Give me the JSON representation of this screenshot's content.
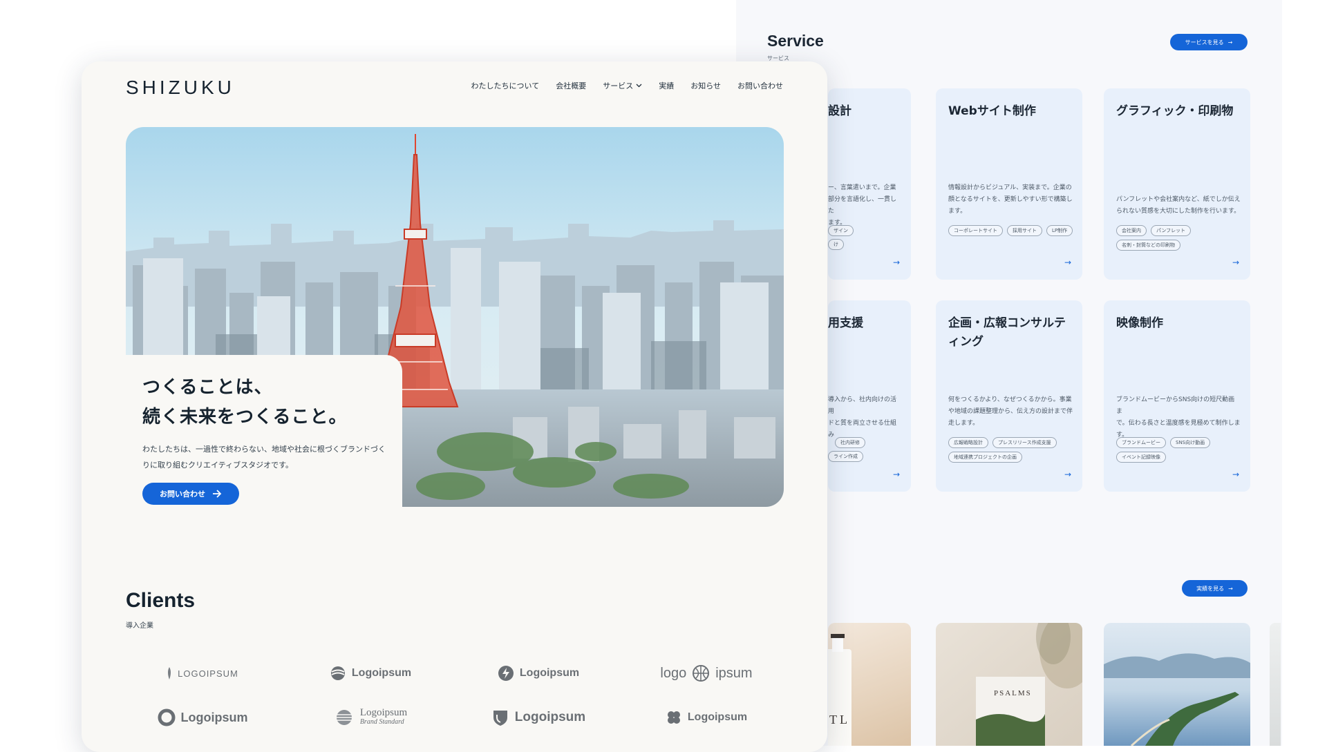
{
  "service_page": {
    "title": "Service",
    "subtitle": "サービス",
    "more_button": "サービスを見る",
    "works_button": "実績を見る",
    "cards": [
      {
        "title": "設計",
        "desc": "ー、言葉遣いまで。企業\n部分を言語化し、一貫した\nます。",
        "tags": [
          "ザイン",
          "け"
        ]
      },
      {
        "title": "Webサイト制作",
        "desc": "情報設計からビジュアル、実装まで。企業の\n顔となるサイトを、更新しやすい形で構築し\nます。",
        "tags": [
          "コーポレートサイト",
          "採用サイト",
          "LP制作"
        ]
      },
      {
        "title": "グラフィック・印刷物",
        "desc": "パンフレットや会社案内など、紙でしか伝え\nられない質感を大切にした制作を行います。",
        "tags": [
          "会社案内",
          "パンフレット",
          "名刺・封筒などの印刷物"
        ]
      },
      {
        "title": "用支援",
        "desc": "導入から、社内向けの活用\nドと質を両立させる仕組み",
        "tags": [
          "社内研修",
          "ライン作成"
        ]
      },
      {
        "title": "企画・広報コンサルティング",
        "desc": "何をつくるかより、なぜつくるかから。事業\nや地域の課題整理から、伝え方の設計まで伴\n走します。",
        "tags": [
          "広報戦略設計",
          "プレスリリース作成支援",
          "地域連携プロジェクトの企画"
        ]
      },
      {
        "title": "映像制作",
        "desc": "ブランドムービーからSNS向けの短尺動画ま\nで。伝わる長さと温度感を見極めて制作しま\nす。",
        "tags": [
          "ブランドムービー",
          "SNS向け動画",
          "イベント記録映像"
        ]
      }
    ],
    "works_images": [
      {
        "caption": "TL"
      },
      {
        "caption": "PSALMS"
      },
      {
        "caption": ""
      }
    ]
  },
  "front_page": {
    "logo": "SHIZUKU",
    "nav": [
      {
        "label": "わたしたちについて"
      },
      {
        "label": "会社概要"
      },
      {
        "label": "サービス",
        "dropdown": true
      },
      {
        "label": "実績"
      },
      {
        "label": "お知らせ"
      },
      {
        "label": "お問い合わせ"
      }
    ],
    "hero": {
      "headline": "つくることは、\n続く未来をつくること。",
      "body": "わたしたちは、一過性で終わらない、地域や社会に根づくブランドづくりに取り組むクリエイティブスタジオです。",
      "cta": "お問い合わせ"
    },
    "clients": {
      "title": "Clients",
      "subtitle": "導入企業",
      "logos": [
        {
          "name": "LOGOIPSUM",
          "icon": "feather-icon"
        },
        {
          "name": "Logoipsum",
          "icon": "wave-icon"
        },
        {
          "name": "Logoipsum",
          "icon": "bolt-icon"
        },
        {
          "name": "logo",
          "name2": "ipsum",
          "icon": "globe-icon"
        },
        {
          "name": "Logoipsum",
          "icon": "ring-icon"
        },
        {
          "name": "Logoipsum",
          "sub": "Brand Standard",
          "icon": "stripe-icon"
        },
        {
          "name": "Logoipsum",
          "icon": "shield-icon"
        },
        {
          "name": "Logoipsum",
          "icon": "clover-icon"
        }
      ]
    }
  },
  "colors": {
    "accent": "#1565d8",
    "card_bg": "#e8f0fb",
    "page_bg": "#f9f8f5",
    "text": "#16232f"
  }
}
